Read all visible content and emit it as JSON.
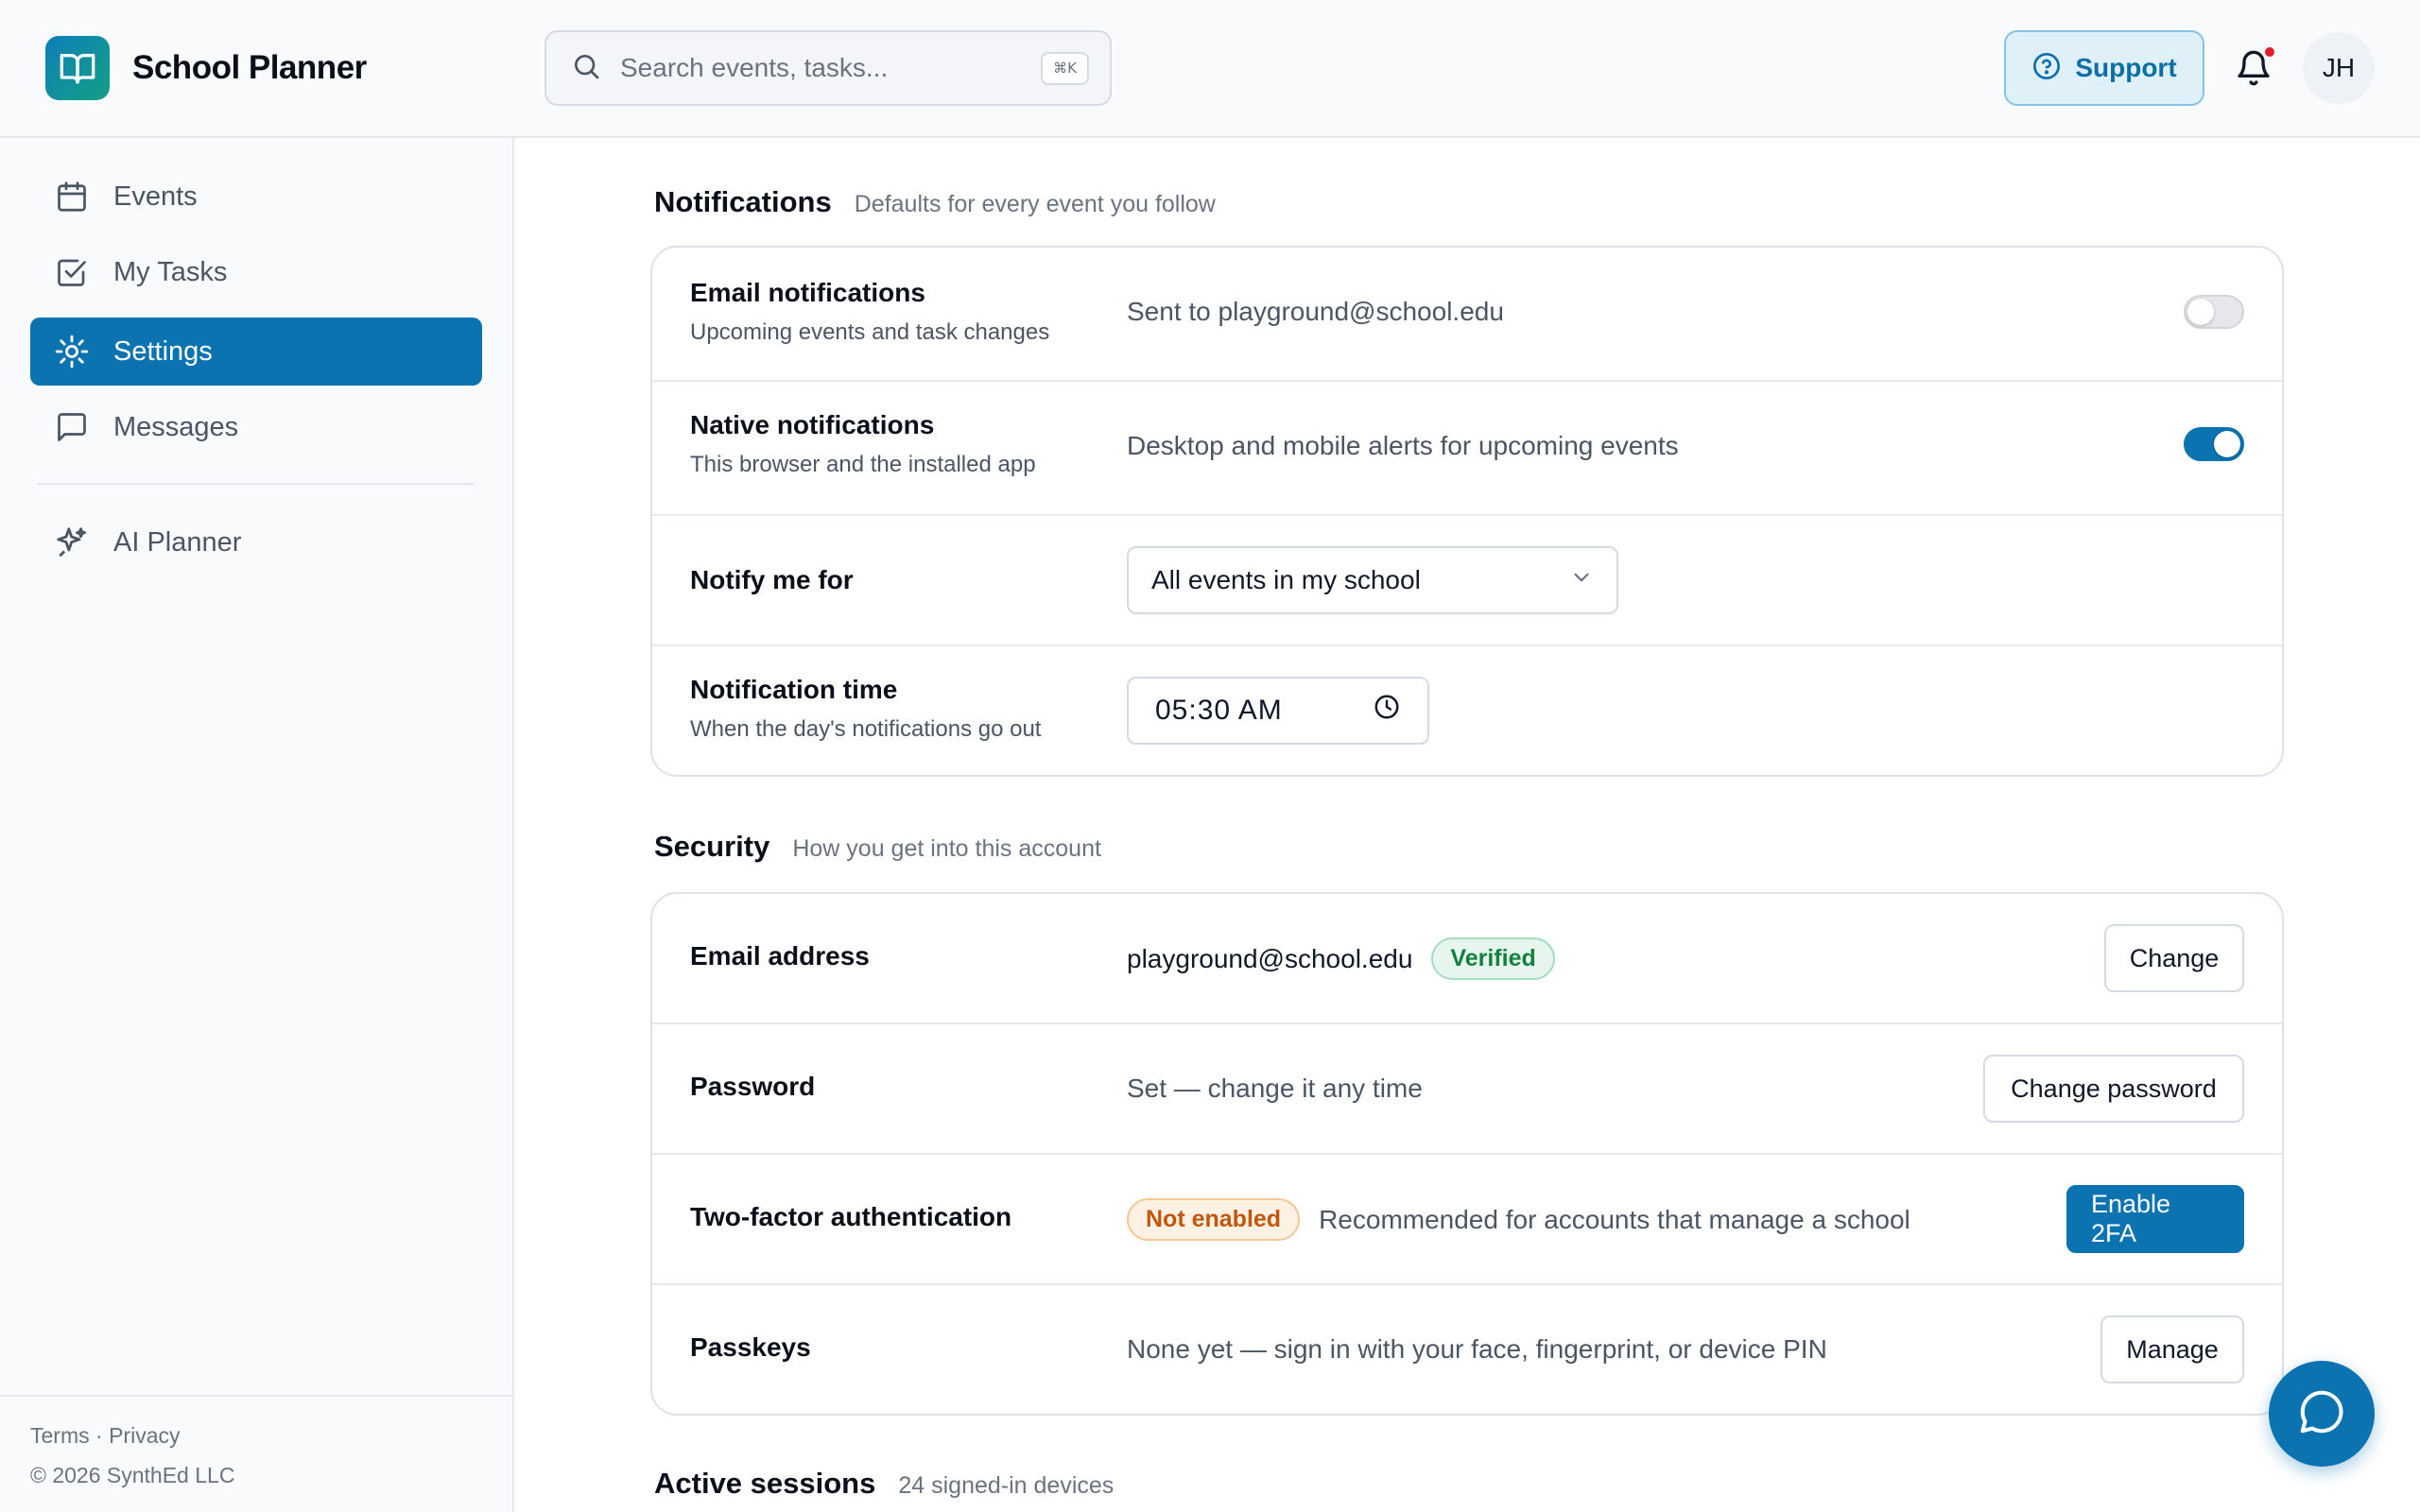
{
  "app": {
    "name": "School Planner"
  },
  "search": {
    "placeholder": "Search events, tasks...",
    "shortcut": "⌘K"
  },
  "header": {
    "support_label": "Support",
    "avatar_initials": "JH",
    "notification_dot": true
  },
  "sidebar": {
    "items": [
      {
        "label": "Events",
        "icon": "calendar-icon",
        "active": false
      },
      {
        "label": "My Tasks",
        "icon": "checkbox-icon",
        "active": false
      },
      {
        "label": "Settings",
        "icon": "sun-gear-icon",
        "active": true
      },
      {
        "label": "Messages",
        "icon": "message-square-icon",
        "active": false
      },
      {
        "label": "AI Planner",
        "icon": "sparkles-icon",
        "active": false
      }
    ],
    "footer": {
      "terms": "Terms",
      "separator": "·",
      "privacy": "Privacy",
      "copyright": "© 2026 SynthEd LLC"
    }
  },
  "notifications": {
    "title": "Notifications",
    "subtitle": "Defaults for every event you follow",
    "email": {
      "label": "Email notifications",
      "desc": "Upcoming events and task changes",
      "info": "Sent to playground@school.edu",
      "enabled": false
    },
    "native": {
      "label": "Native notifications",
      "desc": "This browser and the installed app",
      "info": "Desktop and mobile alerts for upcoming events",
      "enabled": true
    },
    "notify_for": {
      "label": "Notify me for",
      "value": "All events in my school"
    },
    "time": {
      "label": "Notification time",
      "desc": "When the day's notifications go out",
      "value": "05:30 AM"
    }
  },
  "security": {
    "title": "Security",
    "subtitle": "How you get into this account",
    "email": {
      "label": "Email address",
      "value": "playground@school.edu",
      "badge": "Verified",
      "button": "Change"
    },
    "password": {
      "label": "Password",
      "info": "Set — change it any time",
      "button": "Change password"
    },
    "twofa": {
      "label": "Two-factor authentication",
      "badge": "Not enabled",
      "info": "Recommended for accounts that manage a school",
      "button": "Enable 2FA"
    },
    "passkeys": {
      "label": "Passkeys",
      "info": "None yet — sign in with your face, fingerprint, or device PIN",
      "button": "Manage"
    }
  },
  "sessions": {
    "title": "Active sessions",
    "subtitle": "24 signed-in devices"
  },
  "colors": {
    "accent": "#0a73b0",
    "verified": "#15803d",
    "warning": "#c2570c",
    "alert_dot": "#e11d2e"
  }
}
